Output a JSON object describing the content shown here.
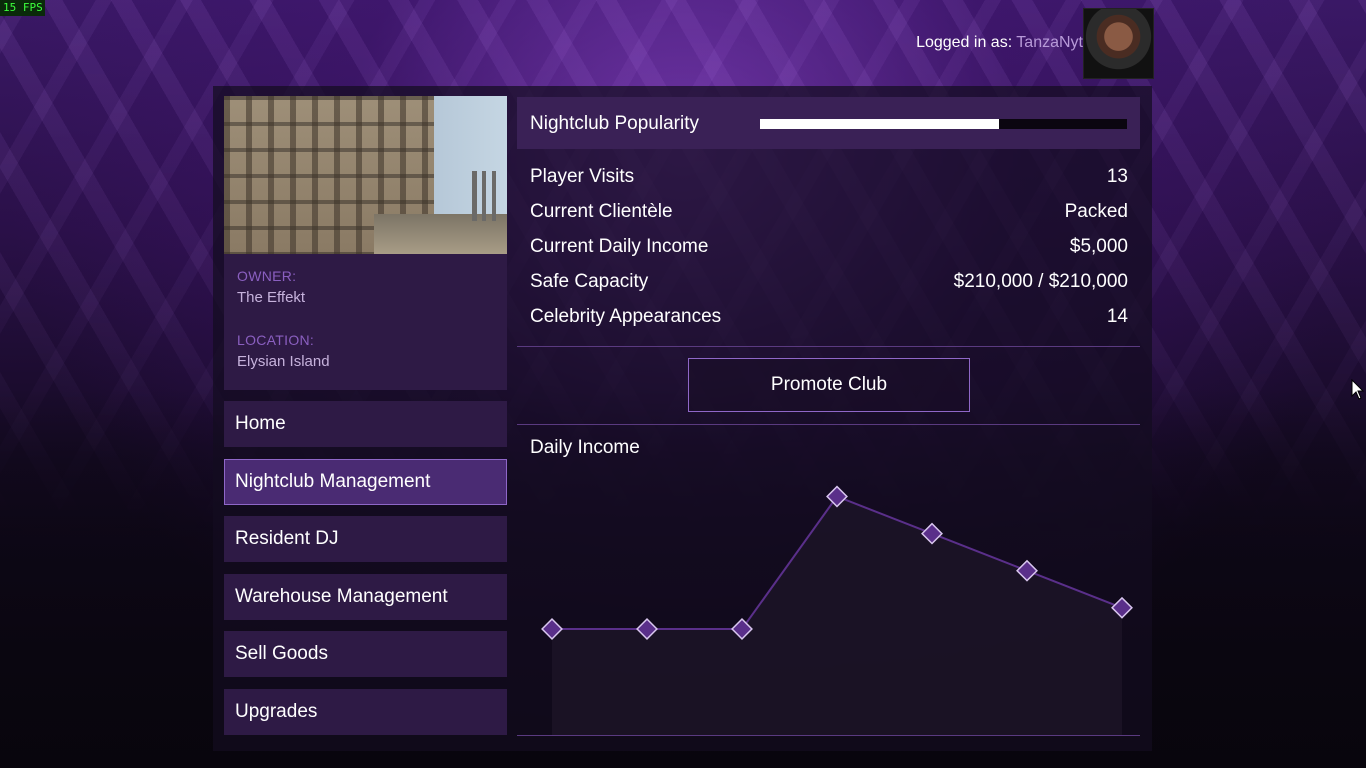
{
  "fps": "15 FPS",
  "header": {
    "login_prefix": "Logged in as:",
    "username": "TanzaNyt"
  },
  "property": {
    "owner_label": "OWNER:",
    "owner_value": "The Effekt",
    "location_label": "LOCATION:",
    "location_value": "Elysian Island"
  },
  "nav": {
    "items": [
      {
        "label": "Home"
      },
      {
        "label": "Nightclub Management"
      },
      {
        "label": "Resident DJ"
      },
      {
        "label": "Warehouse Management"
      },
      {
        "label": "Sell Goods"
      },
      {
        "label": "Upgrades"
      }
    ],
    "active_index": 1
  },
  "popularity": {
    "label": "Nightclub Popularity",
    "level": 0.65
  },
  "stats": [
    {
      "label": "Player Visits",
      "value": "13"
    },
    {
      "label": "Current Clientèle",
      "value": "Packed"
    },
    {
      "label": "Current Daily Income",
      "value": "$5,000"
    },
    {
      "label": "Safe Capacity",
      "value": "$210,000 / $210,000"
    },
    {
      "label": "Celebrity Appearances",
      "value": "14"
    }
  ],
  "actions": {
    "promote_label": "Promote Club"
  },
  "chart_data": {
    "type": "area",
    "title": "Daily Income",
    "x": [
      1,
      2,
      3,
      4,
      5,
      6,
      7
    ],
    "values": [
      2.0,
      2.0,
      2.0,
      4.5,
      3.8,
      3.1,
      2.4
    ],
    "ylim": [
      0,
      5
    ],
    "grid": false,
    "colors": {
      "line": "#5a2f8a",
      "marker": "#5a2f8a",
      "marker_border": "#d9c6ef",
      "fill": "#1e1628"
    }
  }
}
